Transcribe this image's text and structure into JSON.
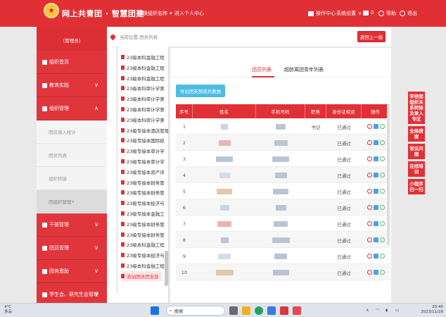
{
  "header": {
    "brand": "网上共青团 · 智慧团建",
    "switch_org": "切换组织名称",
    "personal_center": "进入个人中心",
    "ops_center": "操作中心",
    "settings": "系统设置",
    "message_count": "0",
    "help": "帮助",
    "logout": "退出"
  },
  "sidebar": {
    "org_name": "(管理员)",
    "items": [
      {
        "label": "组织首页",
        "type": "main"
      },
      {
        "label": "教育实践",
        "type": "main",
        "chev": "∨"
      },
      {
        "label": "组织管理",
        "type": "main",
        "chev": "∧"
      },
      {
        "label": "团员录入统计",
        "type": "sub"
      },
      {
        "label": "团员列表",
        "type": "sub"
      },
      {
        "label": "组织转接",
        "type": "sub"
      },
      {
        "label": "团组织管理",
        "type": "sub-dark",
        "chev": "∨"
      },
      {
        "label": "干部管理",
        "type": "main",
        "chev": "∨"
      },
      {
        "label": "团员管理",
        "type": "main",
        "chev": "∨"
      },
      {
        "label": "团务激励",
        "type": "main",
        "chev": "∨"
      },
      {
        "label": "学生会、研究生会管理",
        "type": "main",
        "chev": "∨"
      }
    ]
  },
  "topbar": {
    "location": "当前位置:团员列表",
    "back_button": "返回上一级"
  },
  "tree": {
    "items": [
      "23级本科金融工程",
      "23级本科金融工程",
      "23级本科金融工程",
      "23级本科审计学第",
      "23级本科审计学第",
      "23级本科审计学第",
      "23级本科审计学第",
      "23级专接本酒店管理",
      "23级专接本国际经",
      "23级专接本审计学",
      "23级专接本审计学",
      "23级专接本资产评",
      "23级专接本财务管",
      "23级专接本财务管",
      "23级专接本经济与",
      "23级专接本金融工",
      "23级专接本财务管",
      "23级专接本财务管",
      "23级本科金融工程",
      "23级专接本经济与",
      "23级本科金融工程",
      "流动团员团支部"
    ]
  },
  "main": {
    "tabs": [
      "团员列表",
      "超龄离团青年列表"
    ],
    "export_button": "导出团支部成员数据",
    "columns": [
      "序号",
      "姓名",
      "手机号码",
      "职务",
      "身份证校验",
      "操作"
    ],
    "rows": [
      {
        "no": "1",
        "role": "书记",
        "status": "已通过"
      },
      {
        "no": "2",
        "role": "",
        "status": "已通过"
      },
      {
        "no": "3",
        "role": "",
        "status": "已通过"
      },
      {
        "no": "4",
        "role": "",
        "status": "已通过"
      },
      {
        "no": "5",
        "role": "",
        "status": "已通过"
      },
      {
        "no": "6",
        "role": "",
        "status": "已通过"
      },
      {
        "no": "7",
        "role": "",
        "status": "已通过"
      },
      {
        "no": "8",
        "role": "",
        "status": "已通过"
      },
      {
        "no": "9",
        "role": "",
        "status": "已通过"
      },
      {
        "no": "10",
        "role": "",
        "status": "已通过"
      }
    ]
  },
  "right_float": [
    "学校团组织关系转接及录入专区",
    "全局搜索",
    "常见问题",
    "在线培训",
    "小程序扫一扫"
  ],
  "taskbar": {
    "temp": "4°C",
    "weather": "多云",
    "search": "搜索",
    "time": "20:45",
    "date": "2023/11/28"
  },
  "colors": {
    "brand_red": "#e03036",
    "export_blue": "#4dbde6"
  }
}
